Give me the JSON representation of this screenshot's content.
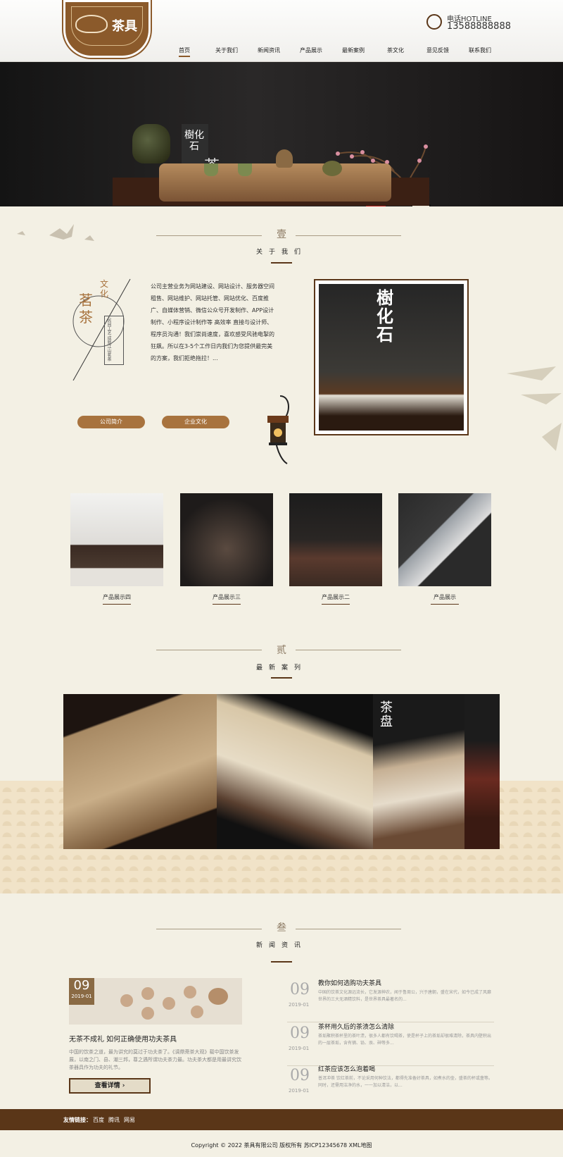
{
  "header": {
    "logo_text": "茶具",
    "hotline_label": "电话HOTLINE",
    "hotline_number": "13588888888",
    "nav": [
      "首页",
      "关于我们",
      "新闻资讯",
      "产品展示",
      "最新案例",
      "茶文化",
      "意见反馈",
      "联系我们"
    ]
  },
  "banner": {
    "calligraphy": "樹化石",
    "char": "茶"
  },
  "about": {
    "num": "壹",
    "title": "关于我们",
    "emblem_big": "茗茶",
    "emblem_small": "文化",
    "emblem_vertical": "民间工艺 成就江山茗茶",
    "text": "公司主营业务为网站建设、网站设计、服务器空间租售、网站维护、网站托管、网站优化、百度推广、自媒体营销、微信公众号开发制作、APP设计制作、小程序设计制作等   高效率 直接与设计师、程序员沟通！我们崇尚速度，喜欢感受风驰电掣的狂飙。所以在3-5个工作日内我们为您提供最完美的方案，我们拒绝拖拉！...",
    "btn_intro": "公司简介",
    "btn_culture": "企业文化",
    "image_calligraphy": "樹化石"
  },
  "products": [
    {
      "label": "产品展示四"
    },
    {
      "label": "产品展示三"
    },
    {
      "label": "产品展示二"
    },
    {
      "label": "产品展示"
    }
  ],
  "cases": {
    "num": "贰",
    "title": "最新案列",
    "badge": "茶盘"
  },
  "news": {
    "num": "叁",
    "title": "新闻资讯",
    "featured": {
      "day": "09",
      "month": "2019-01",
      "title": "无茶不成礼 如何正确使用功夫茶具",
      "desc": "中国的饮茶之道，最为讲究的莫过于功夫茶了。《调鼎斋茶大观》载中国饮茶发展，以南之门、县、潮三邦，尊之遇所谓功夫茶力最。功夫茶大都是用最讲究饮茶器具作为功夫的礼节。",
      "more": "查看详情"
    },
    "items": [
      {
        "day": "09",
        "month": "2019-01",
        "title": "教你如何选购功夫茶具",
        "desc": "中国的饮茶文化源远流长，它发源神农，闻于鲁周公，兴于唐朝，盛在宋代，如今已成了风靡世界的三大无酒精饮料，是世界茶具最著名的..."
      },
      {
        "day": "09",
        "month": "2019-01",
        "title": "茶杯用久后的茶渍怎么清除",
        "desc": "茶垢聚积茶杯里的茶叶渍，很多人都有饮喝茶，使是杯子上的茶垢却很难清除，茶具内壁积出的一层茶垢，含有镉、铅、汞、砷等多..."
      },
      {
        "day": "09",
        "month": "2019-01",
        "title": "红茶应该怎么泡着喝",
        "desc": "普洱冲茶 饮红茶前，不论采用何种饮法，都得先准备好茶具，如煮水的壶，盛茶的杯或盏等。同时，还需用洁净的水，一一加以清洁，以..."
      }
    ]
  },
  "footer": {
    "links_label": "友情链接：",
    "links": [
      "百度",
      "腾讯",
      "网易"
    ],
    "copyright": "Copyright © 2022 茶具有限公司 版权所有 苏ICP12345678 XML地图"
  },
  "colors": {
    "brand": "#8b5a2b",
    "footer": "#5a3618",
    "background": "#f3f0e4"
  }
}
